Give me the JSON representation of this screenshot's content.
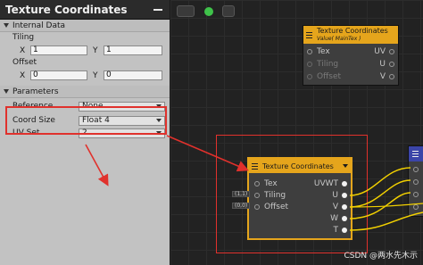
{
  "inspector": {
    "title": "Texture Coordinates",
    "internal_data_section": "Internal Data",
    "tiling_label": "Tiling",
    "tiling_x_axis": "X",
    "tiling_x": "1",
    "tiling_y_axis": "Y",
    "tiling_y": "1",
    "offset_label": "Offset",
    "offset_x_axis": "X",
    "offset_x": "0",
    "offset_y_axis": "Y",
    "offset_y": "0",
    "parameters_section": "Parameters",
    "reference_label": "Reference",
    "reference_value": "None",
    "coord_size_label": "Coord Size",
    "coord_size_value": "Float 4",
    "uv_set_label": "UV Set",
    "uv_set_value": "2"
  },
  "node_top": {
    "title": "Texture Coordinates",
    "subtitle": "Value( MainTex )",
    "inputs": [
      "Tex",
      "Tiling",
      "Offset"
    ],
    "outputs": [
      "UV",
      "U",
      "V"
    ]
  },
  "node_main": {
    "title": "Texture Coordinates",
    "inputs": [
      "Tex",
      "Tiling",
      "Offset"
    ],
    "outputs": [
      "UVWT",
      "U",
      "V",
      "W",
      "T"
    ],
    "tiling_chip": "(1,1)",
    "offset_chip": "(0,0)"
  },
  "watermark": "CSDN @两水先木示",
  "colors": {
    "node_header": "#e5a51c",
    "highlight": "#e0312c",
    "wire": "#f2d000",
    "toolbar_green": "#3fc24a"
  }
}
